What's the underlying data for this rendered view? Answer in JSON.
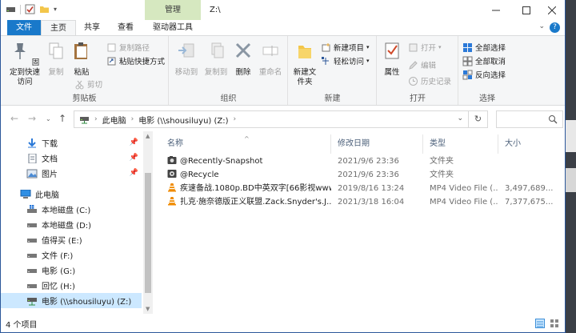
{
  "window": {
    "title": "Z:\\",
    "context_tab": "管理"
  },
  "ribbon_tabs": [
    "文件",
    "主页",
    "共享",
    "查看",
    "驱动器工具"
  ],
  "ribbon": {
    "clipboard": {
      "label": "剪贴板",
      "pin": "固定到快速访问",
      "copy": "复制",
      "paste": "粘贴",
      "cut": "剪切",
      "copy_path": "复制路径",
      "paste_shortcut": "粘贴快捷方式"
    },
    "organize": {
      "label": "组织",
      "move_to": "移动到",
      "copy_to": "复制到",
      "delete": "删除",
      "rename": "重命名"
    },
    "new": {
      "label": "新建",
      "new_folder": "新建文件夹",
      "new_item": "新建项目",
      "easy_access": "轻松访问"
    },
    "open": {
      "label": "打开",
      "properties": "属性",
      "open": "打开",
      "edit": "编辑",
      "history": "历史记录"
    },
    "select": {
      "label": "选择",
      "select_all": "全部选择",
      "select_none": "全部取消",
      "invert": "反向选择"
    }
  },
  "address": {
    "crumbs": [
      "此电脑",
      "电影 (\\\\shousiluyu) (Z:)"
    ]
  },
  "nav_pane": {
    "quick": [
      {
        "label": "下载",
        "icon": "download-arrow-icon",
        "pinned": true
      },
      {
        "label": "文档",
        "icon": "document-icon",
        "pinned": true
      },
      {
        "label": "图片",
        "icon": "picture-icon",
        "pinned": true
      }
    ],
    "this_pc": "此电脑",
    "drives": [
      {
        "label": "本地磁盘 (C:)",
        "icon": "windows-drive-icon"
      },
      {
        "label": "本地磁盘 (D:)",
        "icon": "drive-icon"
      },
      {
        "label": "值得买 (E:)",
        "icon": "drive-icon"
      },
      {
        "label": "文件 (F:)",
        "icon": "drive-icon"
      },
      {
        "label": "电影 (G:)",
        "icon": "drive-icon"
      },
      {
        "label": "回忆 (H:)",
        "icon": "drive-icon"
      },
      {
        "label": "电影 (\\\\shousiluyu) (Z:)",
        "icon": "network-drive-icon",
        "selected": true
      }
    ]
  },
  "columns": [
    "名称",
    "修改日期",
    "类型",
    "大小"
  ],
  "files": [
    {
      "name": "@Recently-Snapshot",
      "date": "2021/9/6 23:36",
      "type": "文件夹",
      "size": "",
      "icon": "camera-folder-icon"
    },
    {
      "name": "@Recycle",
      "date": "2021/9/6 23:36",
      "type": "文件夹",
      "size": "",
      "icon": "recycle-folder-icon"
    },
    {
      "name": "疾速备战.1080p.BD中英双字[66影视www...",
      "date": "2019/8/16 13:24",
      "type": "MP4 Video File (...",
      "size": "3,497,689...",
      "icon": "vlc-cone-icon"
    },
    {
      "name": "扎克·施奈德版正义联盟.Zack.Snyder's.J...",
      "date": "2021/3/18 16:04",
      "type": "MP4 Video File (...",
      "size": "7,377,675...",
      "icon": "vlc-cone-icon"
    }
  ],
  "status": {
    "count_text": "4 个项目"
  }
}
